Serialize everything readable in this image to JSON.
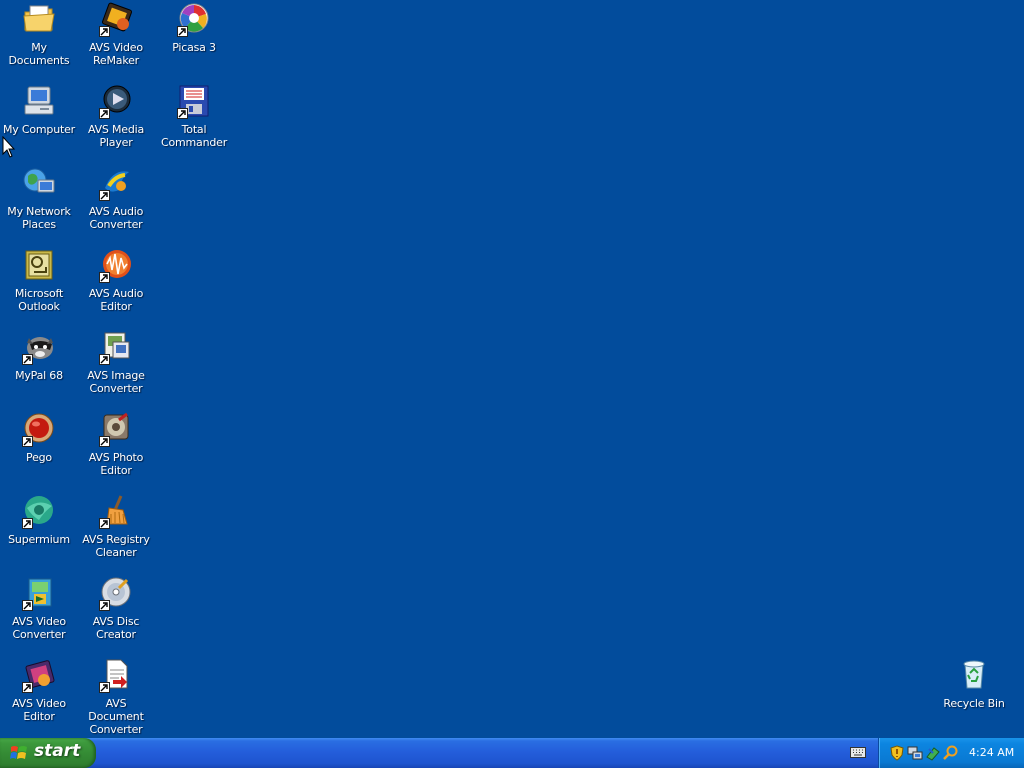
{
  "desktop": {
    "icons": [
      {
        "label": "My Documents",
        "icon": "folder-documents-icon"
      },
      {
        "label": "My Computer",
        "icon": "computer-icon"
      },
      {
        "label": "My Network Places",
        "icon": "network-globe-icon"
      },
      {
        "label": "Microsoft Outlook",
        "icon": "outlook-icon"
      },
      {
        "label": "MyPal 68",
        "icon": "raccoon-browser-icon"
      },
      {
        "label": "Pego",
        "icon": "red-orb-icon"
      },
      {
        "label": "Supermium",
        "icon": "teal-browser-icon"
      },
      {
        "label": "AVS Video Converter",
        "icon": "video-converter-icon"
      },
      {
        "label": "AVS Video Editor",
        "icon": "film-editor-icon"
      },
      {
        "label": "AVS Video ReMaker",
        "icon": "film-remaker-icon"
      },
      {
        "label": "AVS Media Player",
        "icon": "media-player-icon"
      },
      {
        "label": "AVS Audio Converter",
        "icon": "audio-converter-icon"
      },
      {
        "label": "AVS Audio Editor",
        "icon": "audio-wave-icon"
      },
      {
        "label": "AVS Image Converter",
        "icon": "image-converter-icon"
      },
      {
        "label": "AVS Photo Editor",
        "icon": "photo-editor-icon"
      },
      {
        "label": "AVS Registry Cleaner",
        "icon": "broom-icon"
      },
      {
        "label": "AVS Disc Creator",
        "icon": "disc-icon"
      },
      {
        "label": "AVS Document Converter",
        "icon": "document-converter-icon"
      },
      {
        "label": "Picasa 3",
        "icon": "picasa-icon"
      },
      {
        "label": "Total Commander",
        "icon": "floppy-disk-icon"
      },
      {
        "label": "Recycle Bin",
        "icon": "recycle-bin-icon"
      }
    ]
  },
  "taskbar": {
    "start_label": "start",
    "clock": "4:24 AM",
    "tray_icons": [
      "security-shield-icon",
      "network-icon",
      "safely-remove-icon",
      "search-icon"
    ],
    "keyboard_icon": "keyboard-icon"
  },
  "colors": {
    "desktop_background": "#024c9c",
    "taskbar_blue": "#245edb",
    "start_green": "#3d9a3d"
  }
}
